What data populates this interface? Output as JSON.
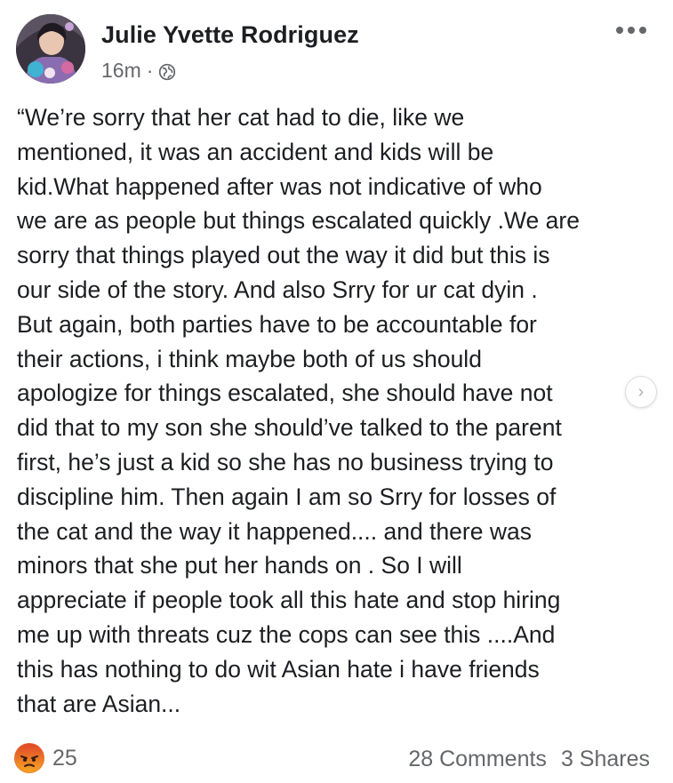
{
  "post": {
    "author": "Julie Yvette Rodriguez",
    "time": "16m",
    "separator": "·",
    "privacy_icon": "globe-icon",
    "more_icon": "more-options-icon",
    "lines": [
      "“We’re sorry that her cat had to die, like we",
      "mentioned, it was an accident and kids will be",
      "kid.What happened after was not indicative of who",
      "we are as people but things escalated quickly .We are",
      "sorry that things played out the way it did but this is",
      "our side of the story. And also Srry for ur cat dyin .",
      "But again, both parties have to be accountable for",
      "their actions, i think maybe both of us should",
      "apologize for things escalated, she should have not",
      "did that to my son she should’ve talked to the parent",
      "first, he’s just a kid so she has no business trying to",
      "discipline him. Then again I am so Srry for losses of",
      "the cat and the way it happened.... and there was",
      "minors that she put her hands on . So I will",
      "appreciate if people took all this hate and stop hiring",
      "me up with threats cuz the cops can see this ....And",
      "this has nothing to do wit Asian hate i have friends",
      "that are Asian..."
    ],
    "next_icon": "chevron-right-icon",
    "next_glyph": "›"
  },
  "footer": {
    "reaction_icon": "angry-reaction-icon",
    "reaction_count": "25",
    "comments": "28 Comments",
    "shares": "3 Shares"
  },
  "colors": {
    "text": "#1c1e21",
    "secondary": "#65676b",
    "angry_top": "#e0472a",
    "angry_bottom": "#f5a623"
  }
}
